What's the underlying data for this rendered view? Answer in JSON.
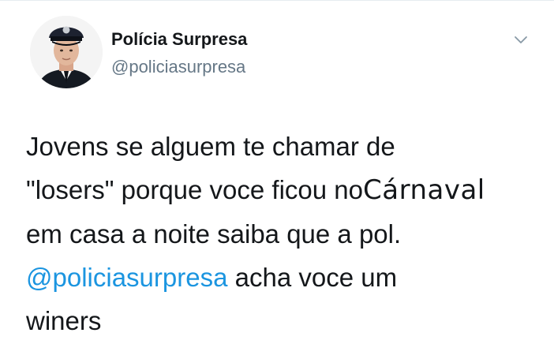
{
  "author": {
    "display_name": "Polícia Surpresa",
    "handle": "@policiasurpresa"
  },
  "menu_icon": "chevron-down-icon",
  "tweet": {
    "line1": "Jovens se alguem te chamar  de",
    "line2_prefix": "\"losers\" porque voce ficou no",
    "line2_word": "Cárnaval",
    "line3": "em casa a noite saiba que a pol.",
    "mention": "@policiasurpresa",
    "line4_suffix": " acha voce um",
    "line5": "winers"
  },
  "colors": {
    "link": "#1b95e0",
    "text": "#14171a",
    "secondary": "#657786"
  }
}
